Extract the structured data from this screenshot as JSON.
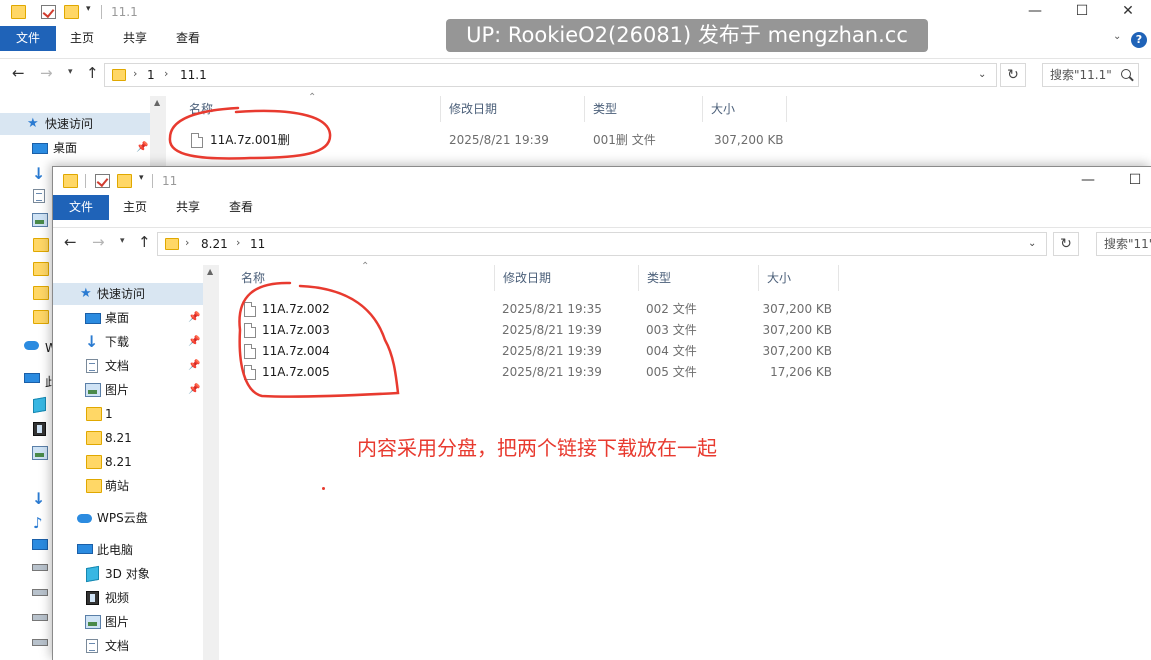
{
  "watermark": "UP: RookieO2(26081) 发布于 mengzhan.cc",
  "annotation": "内容采用分盘，把两个链接下载放在一起",
  "ribbon_tabs": [
    "文件",
    "主页",
    "共享",
    "查看"
  ],
  "columns": {
    "name": "名称",
    "modified": "修改日期",
    "type": "类型",
    "size": "大小"
  },
  "back_window": {
    "title": "11.1",
    "breadcrumb": [
      "1",
      "11.1"
    ],
    "search_placeholder": "搜索\"11.1\"",
    "nav_quick_access": "快速访问",
    "nav_desktop": "桌面",
    "nav_wps_partial": "W",
    "nav_pc_partial": "此",
    "files": [
      {
        "name": "11A.7z.001删",
        "modified": "2025/8/21 19:39",
        "type": "001删 文件",
        "size": "307,200 KB"
      }
    ]
  },
  "front_window": {
    "title": "11",
    "breadcrumb": [
      "8.21",
      "11"
    ],
    "search_placeholder": "搜索\"11\"",
    "nav": {
      "quick_access": "快速访问",
      "desktop": "桌面",
      "downloads": "下载",
      "documents": "文档",
      "pictures": "图片",
      "folder_1": "1",
      "folder_821a": "8.21",
      "folder_821b": "8.21",
      "folder_mengzhan": "萌站",
      "wps_cloud": "WPS云盘",
      "this_pc": "此电脑",
      "objects_3d": "3D 对象",
      "videos": "视频",
      "pictures2": "图片",
      "documents2": "文档"
    },
    "files": [
      {
        "name": "11A.7z.002",
        "modified": "2025/8/21 19:35",
        "type": "002 文件",
        "size": "307,200 KB"
      },
      {
        "name": "11A.7z.003",
        "modified": "2025/8/21 19:39",
        "type": "003 文件",
        "size": "307,200 KB"
      },
      {
        "name": "11A.7z.004",
        "modified": "2025/8/21 19:39",
        "type": "004 文件",
        "size": "307,200 KB"
      },
      {
        "name": "11A.7z.005",
        "modified": "2025/8/21 19:39",
        "type": "005 文件",
        "size": "17,206 KB"
      }
    ]
  },
  "window_controls": {
    "minimize": "—",
    "maximize": "☐",
    "close": "✕"
  },
  "icons": [
    "folder-icon",
    "properties-icon",
    "back-arrow-icon",
    "forward-arrow-icon",
    "up-arrow-icon",
    "refresh-icon",
    "search-icon",
    "pin-icon",
    "help-icon",
    "file-icon"
  ],
  "annotation_color": "#e83a2f",
  "accent_color": "#1f63b8"
}
